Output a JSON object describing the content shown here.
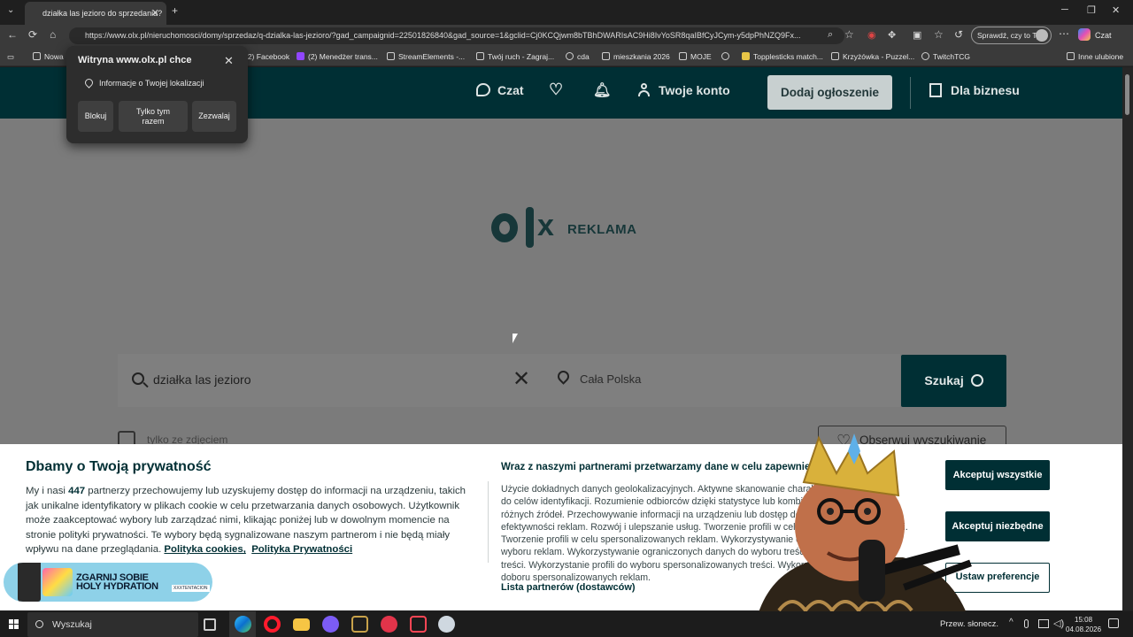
{
  "browser": {
    "tab_title": "działka las jezioro do sprzedania?",
    "url": "https://www.olx.pl/nieruchomosci/domy/sprzedaz/q-dzialka-las-jezioro/?gad_campaignid=22501826840&gad_source=1&gclid=Cj0KCQjwm8bTBhDWARIsAC9Hi8IvYoSR8qaIBfCyJCym-y5dpPhNZQ9Fx...",
    "profile_button": "Sprawdź, czy to Ty",
    "copilot_label": "Czat",
    "bookmarks": [
      "Nowa",
      "(2) Facebook",
      "(2) Menedżer trans...",
      "StreamElements -...",
      "Twój ruch - Zagraj...",
      "cda",
      "mieszkania 2026",
      "MOJE",
      "Topplesticks match...",
      "Krzyżówka - Puzzel...",
      "TwitchTCG",
      "Inne ulubione"
    ]
  },
  "permission_popup": {
    "title": "Witryna www.olx.pl chce",
    "info": "Informacje o Twojej lokalizacji",
    "block": "Blokuj",
    "once": "Tylko tym razem",
    "allow": "Zezwalaj"
  },
  "header": {
    "chat": "Czat",
    "account": "Twoje konto",
    "post_ad": "Dodaj ogłoszenie",
    "business": "Dla biznesu"
  },
  "logo": {
    "ad_label": "REKLAMA"
  },
  "search": {
    "query": "działka las jezioro",
    "location": "Cała Polska",
    "button": "Szukaj",
    "photo_only": "tylko ze zdjęciem",
    "watch": "Obserwuj wyszukiwanie"
  },
  "cookie": {
    "title": "Dbamy o Twoją prywatność",
    "body_pre": "My i nasi ",
    "partner_count": "447",
    "body_post": " partnerzy przechowujemy lub uzyskujemy dostęp do informacji na urządzeniu, takich jak unikalne identyfikatory w plikach cookie w celu przetwarzania danych osobowych. Użytkownik może zaakceptować wybory lub zarządzać nimi, klikając poniżej lub w dowolnym momencie na stronie polityki prywatności. Te wybory będą sygnalizowane naszym partnerom i nie będą miały wpływu na dane przeglądania. ",
    "cookies_policy": "Polityka cookies,",
    "privacy_policy": "Polityka Prywatności",
    "right_title": "Wraz z naszymi partnerami przetwarzamy dane w celu zapewnienia:",
    "right_body": "Użycie dokładnych danych geolokalizacyjnych. Aktywne skanowanie charakterystyki urządzenia do celów identyfikacji. Rozumienie odbiorców dzięki statystyce lub kombinacjom danych z różnych źródeł. Przechowywanie informacji na urządzeniu lub dostęp do nich. Pomiar efektywności reklam. Rozwój i ulepszanie usług. Tworzenie profili w celu spersonalizowania treści. Tworzenie profili w celu spersonalizowanych reklam. Wykorzystywanie ograniczonych danych do wyboru reklam. Wykorzystywanie ograniczonych danych do wyboru treści. Pomiar efektywności treści. Wykorzystanie profili do wyboru spersonalizowanych treści. Wykorzystywanie profili w celu doboru spersonalizowanych reklam.",
    "partners_list": "Lista partnerów (dostawców)",
    "accept_all": "Akceptuj wszystkie",
    "accept_necessary": "Akceptuj niezbędne",
    "set_preferences": "Ustaw preferencje"
  },
  "ad": {
    "text": "ZGARNIJ SOBIE HOLY HYDRATION",
    "brand": "XXXTENTACION"
  },
  "taskbar": {
    "search": "Wyszukaj",
    "weather": "Przew. słonecz.",
    "time": "15:08",
    "date": "04.08.2026"
  },
  "colors": {
    "olx_dark": "#002f34",
    "white": "#ffffff"
  }
}
